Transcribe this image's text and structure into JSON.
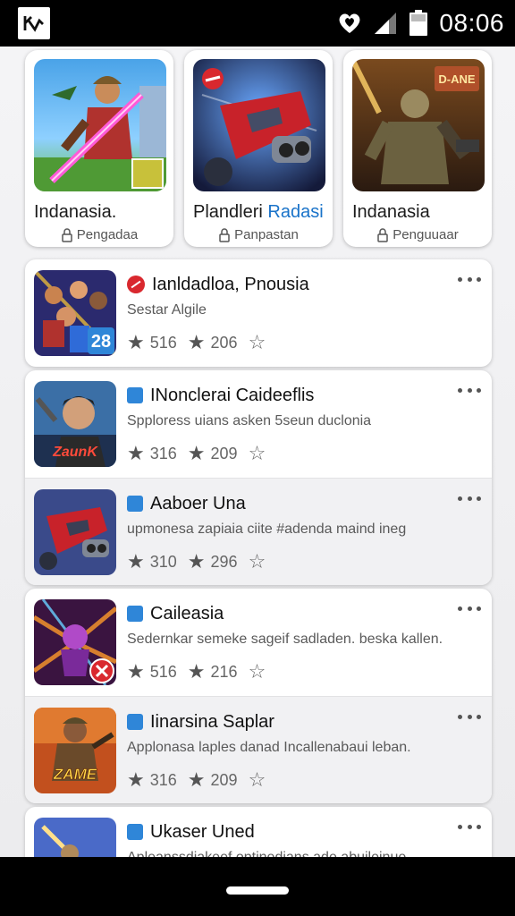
{
  "status_bar": {
    "time": "08:06",
    "icons": [
      "app-notification-icon",
      "heart-icon",
      "signal-icon",
      "battery-icon"
    ]
  },
  "featured": [
    {
      "title": "Indanasia.",
      "title_accent": "",
      "subtitle": "Pengadaa",
      "thumb": "soldier-sword-art"
    },
    {
      "title": "Plandleri ",
      "title_accent": "Radasi",
      "subtitle": "Panpastan",
      "thumb": "red-spaceship-art"
    },
    {
      "title": "Indanasia",
      "title_accent": "",
      "subtitle": "Penguuaar",
      "thumb": "armored-warrior-art",
      "thumb_caption": "D-ANE"
    }
  ],
  "list": [
    {
      "title": "Ianldadloa, Pnousia",
      "description": "Sestar Algile",
      "badge": "red-round",
      "rating_a": "516",
      "rating_b": "206",
      "thumb": "hero-group-art",
      "thumb_caption": "28"
    },
    {
      "title": "INonclerai Caideeflis",
      "description": "Spplоress uians asken 5seun duclonia",
      "badge": "blue-square",
      "rating_a": "316",
      "rating_b": "209",
      "thumb": "man-portrait-art",
      "thumb_caption": "ZaunK"
    },
    {
      "title": "Aaboer Una",
      "description": "upmonesa zapiaia ciite #adenda maind ineg",
      "badge": "blue-square",
      "rating_a": "310",
      "rating_b": "296",
      "thumb": "red-spaceship-art"
    },
    {
      "title": "Caileasia",
      "description": "Sedernkar semeke sageif sadladen. beska kallen.",
      "badge": "blue-square",
      "rating_a": "516",
      "rating_b": "216",
      "thumb": "purple-burst-art"
    },
    {
      "title": "Iinarsina Saplar",
      "description": "Applonasa laples danad Incallenabaui leban.",
      "badge": "blue-square",
      "rating_a": "316",
      "rating_b": "209",
      "thumb": "soldier-fire-art",
      "thumb_caption": "ZAME"
    },
    {
      "title": "Ukaser Uned",
      "description": "Apleanssdiakeef optinedians ade abuileinue",
      "badge": "blue-square",
      "rating_a": "",
      "rating_b": "",
      "thumb": "battle-scene-art"
    }
  ],
  "colors": {
    "accent_blue": "#2f86d8",
    "badge_red": "#d9282e",
    "link_blue": "#1a73c9",
    "background": "#ececee"
  }
}
